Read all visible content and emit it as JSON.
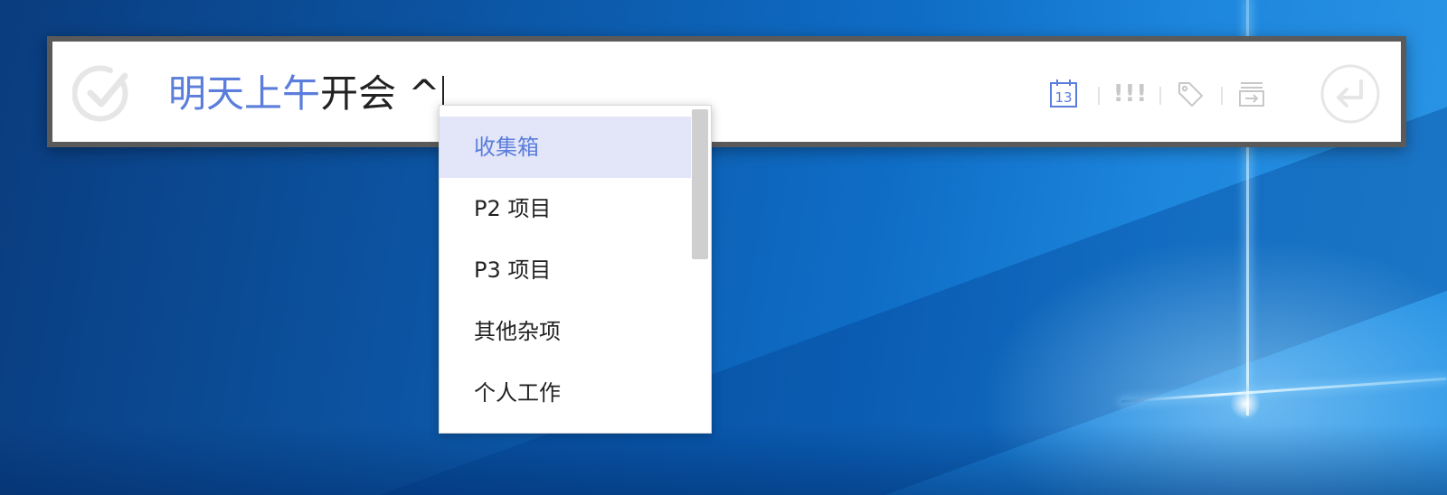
{
  "quick_add": {
    "input": {
      "date_text": "明天上午",
      "rest_text": "开会 ^"
    }
  },
  "toolbar": {
    "date_icon_day": "13",
    "priority_icon_text": "!!!"
  },
  "dropdown": {
    "items": [
      {
        "label": "收集箱",
        "selected": true
      },
      {
        "label": "P2 项目",
        "selected": false
      },
      {
        "label": "P3 项目",
        "selected": false
      },
      {
        "label": "其他杂项",
        "selected": false
      },
      {
        "label": "个人工作",
        "selected": false
      }
    ],
    "scroll_fraction_visible": 0.45
  },
  "colors": {
    "accent": "#5b7ddb",
    "frame": "#5a5a5a",
    "icon_gray": "#c8c8c8",
    "selected_bg": "#e3e6f8"
  }
}
